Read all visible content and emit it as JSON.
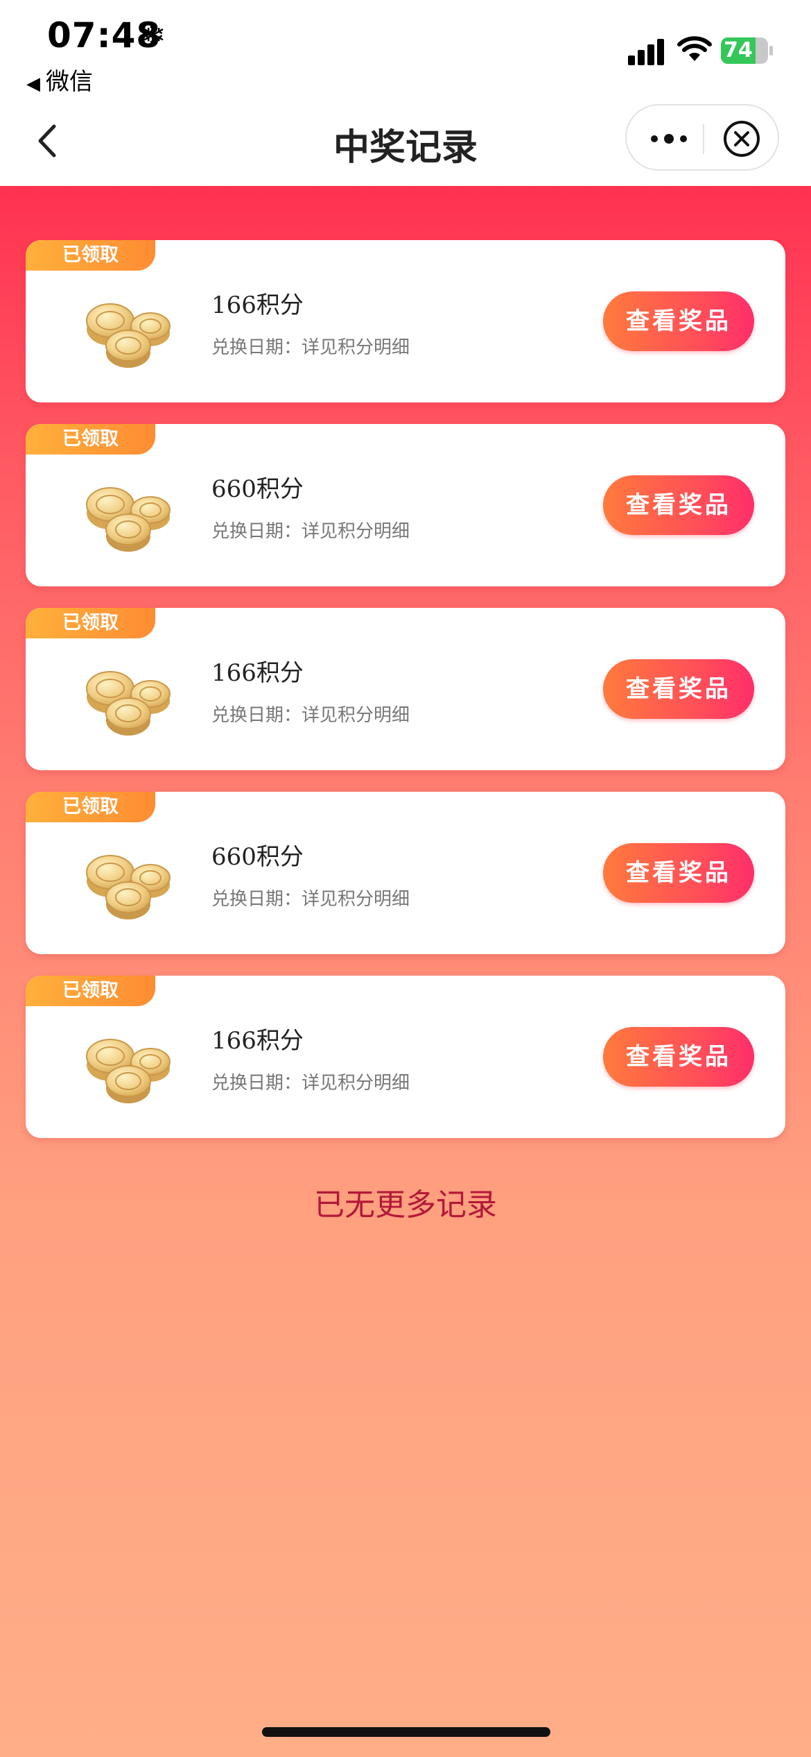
{
  "status_bar": {
    "time": "07:48",
    "indicator_glyph": "❄",
    "back_app": "微信",
    "battery": "74",
    "battery_color": "#34c759"
  },
  "nav": {
    "title": "中奖记录",
    "icons": [
      "chevron-left-icon",
      "more-dots-icon",
      "close-circle-icon"
    ]
  },
  "records": [
    {
      "badge": "已领取",
      "name": "166积分",
      "date": "兑换日期：详见积分明细",
      "button": "查看奖品"
    },
    {
      "badge": "已领取",
      "name": "660积分",
      "date": "兑换日期：详见积分明细",
      "button": "查看奖品"
    },
    {
      "badge": "已领取",
      "name": "166积分",
      "date": "兑换日期：详见积分明细",
      "button": "查看奖品"
    },
    {
      "badge": "已领取",
      "name": "660积分",
      "date": "兑换日期：详见积分明细",
      "button": "查看奖品"
    },
    {
      "badge": "已领取",
      "name": "166积分",
      "date": "兑换日期：详见积分明细",
      "button": "查看奖品"
    }
  ],
  "footer": {
    "no_more": "已无更多记录"
  },
  "colors": {
    "background_top": "#ff3151",
    "background_bottom": "#ffae88",
    "badge": "#ff9a36",
    "button": "#ff4d5a",
    "footer_text": "#b21838"
  }
}
